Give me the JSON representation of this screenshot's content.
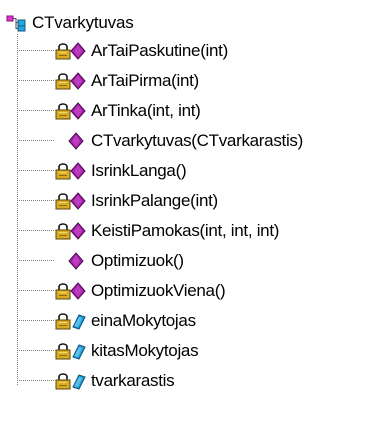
{
  "tree": {
    "root": {
      "label": "CTvarkytuvas",
      "icon": "class-icon"
    },
    "items": [
      {
        "label": "ArTaiPaskutine(int)",
        "icon": "protected-method-icon"
      },
      {
        "label": "ArTaiPirma(int)",
        "icon": "protected-method-icon"
      },
      {
        "label": "ArTinka(int, int)",
        "icon": "protected-method-icon"
      },
      {
        "label": "CTvarkytuvas(CTvarkarastis)",
        "icon": "public-method-icon"
      },
      {
        "label": "IsrinkLanga()",
        "icon": "protected-method-icon"
      },
      {
        "label": "IsrinkPalange(int)",
        "icon": "protected-method-icon"
      },
      {
        "label": "KeistiPamokas(int, int, int)",
        "icon": "protected-method-icon"
      },
      {
        "label": "Optimizuok()",
        "icon": "public-method-icon"
      },
      {
        "label": "OptimizuokViena()",
        "icon": "protected-method-icon"
      },
      {
        "label": "einaMokytojas",
        "icon": "protected-field-icon"
      },
      {
        "label": "kitasMokytojas",
        "icon": "protected-field-icon"
      },
      {
        "label": "tvarkarastis",
        "icon": "protected-field-icon"
      }
    ]
  },
  "colors": {
    "method": "#a51ea8",
    "field": "#1f9fd8",
    "lock": "#c79a18",
    "class_primary": "#e72fd0",
    "class_secondary": "#21a8e6",
    "tree_line": "#7f7f7f"
  }
}
